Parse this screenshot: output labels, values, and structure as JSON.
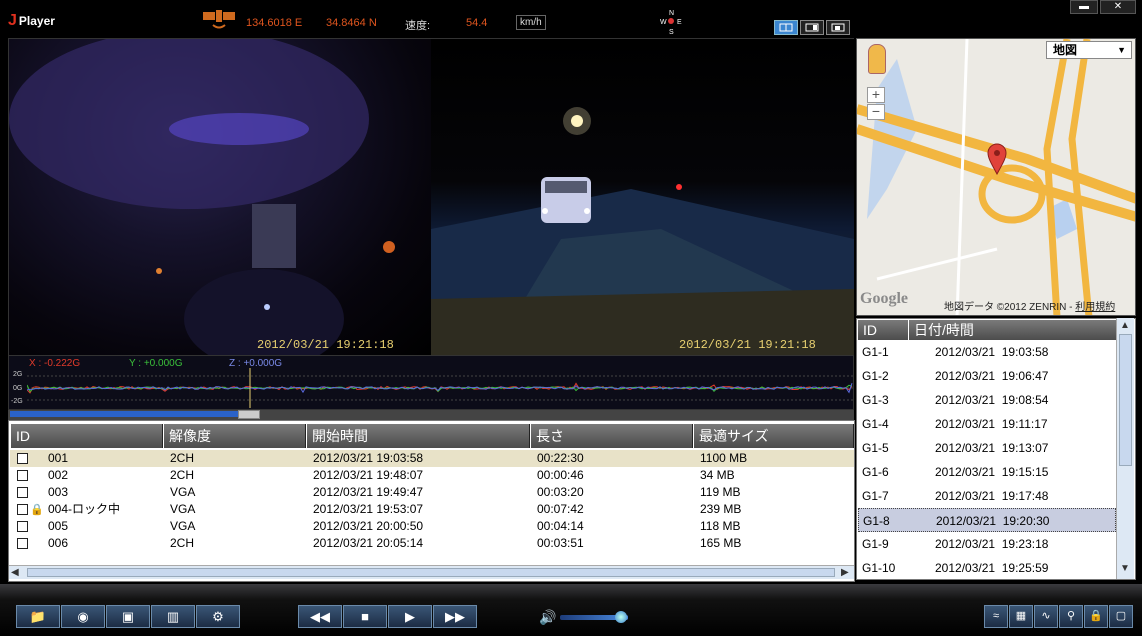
{
  "app": {
    "title": "Player",
    "logo_letter": "J"
  },
  "status": {
    "longitude": "134.6018 E",
    "latitude": "34.8464 N",
    "speed_label": "速度:",
    "speed_value": "54.4",
    "speed_unit": "km/h",
    "compass_letters": [
      "N",
      "W",
      "E",
      "S"
    ]
  },
  "window_controls": {
    "minimize": "▬",
    "close": "✕"
  },
  "video": {
    "left_timestamp": "2012/03/21   19:21:18",
    "right_timestamp": "2012/03/21   19:21:18"
  },
  "accel": {
    "x_label": "X : -0.222G",
    "y_label": "Y : +0.000G",
    "z_label": "Z : +0.000G",
    "y_ticks": [
      "2G",
      "0G",
      "-2G"
    ],
    "colors": {
      "x": "#e03a2a",
      "y": "#3ac03a",
      "z": "#5a6ae0"
    }
  },
  "playback": {
    "progress": 0.28
  },
  "files": {
    "headers": [
      "ID",
      "解像度",
      "開始時間",
      "長さ",
      "最適サイズ"
    ],
    "rows": [
      {
        "id": "001",
        "res": "2CH",
        "start": "2012/03/21 19:03:58",
        "len": "00:22:30",
        "size": "1100 MB",
        "selected": true,
        "locked": false
      },
      {
        "id": "002",
        "res": "2CH",
        "start": "2012/03/21 19:48:07",
        "len": "00:00:46",
        "size": "34 MB",
        "selected": false,
        "locked": false
      },
      {
        "id": "003",
        "res": "VGA",
        "start": "2012/03/21 19:49:47",
        "len": "00:03:20",
        "size": "119 MB",
        "selected": false,
        "locked": false
      },
      {
        "id": "004-ロック中",
        "res": "VGA",
        "start": "2012/03/21 19:53:07",
        "len": "00:07:42",
        "size": "239 MB",
        "selected": false,
        "locked": true
      },
      {
        "id": "005",
        "res": "VGA",
        "start": "2012/03/21 20:00:50",
        "len": "00:04:14",
        "size": "118 MB",
        "selected": false,
        "locked": false
      },
      {
        "id": "006",
        "res": "2CH",
        "start": "2012/03/21 20:05:14",
        "len": "00:03:51",
        "size": "165 MB",
        "selected": false,
        "locked": false
      }
    ]
  },
  "map": {
    "type_select": "地図",
    "credit_prefix": "地図データ ©2012 ZENRIN - ",
    "terms_link": "利用規約",
    "google_text": "Google",
    "zoom_in": "+",
    "zoom_out": "−"
  },
  "segments": {
    "headers": [
      "ID",
      "日付/時間"
    ],
    "rows": [
      {
        "id": "G1-1",
        "dt": "2012/03/21  19:03:58",
        "selected": false
      },
      {
        "id": "G1-2",
        "dt": "2012/03/21  19:06:47",
        "selected": false
      },
      {
        "id": "G1-3",
        "dt": "2012/03/21  19:08:54",
        "selected": false
      },
      {
        "id": "G1-4",
        "dt": "2012/03/21  19:11:17",
        "selected": false
      },
      {
        "id": "G1-5",
        "dt": "2012/03/21  19:13:07",
        "selected": false
      },
      {
        "id": "G1-6",
        "dt": "2012/03/21  19:15:15",
        "selected": false
      },
      {
        "id": "G1-7",
        "dt": "2012/03/21  19:17:48",
        "selected": false
      },
      {
        "id": "G1-8",
        "dt": "2012/03/21  19:20:30",
        "selected": true
      },
      {
        "id": "G1-9",
        "dt": "2012/03/21  19:23:18",
        "selected": false
      },
      {
        "id": "G1-10",
        "dt": "2012/03/21  19:25:59",
        "selected": false
      }
    ]
  },
  "toolbar": {
    "left_icons": [
      "folder-icon",
      "camera-icon",
      "save-icon",
      "trash-icon",
      "gear-icon"
    ],
    "left_glyphs": [
      "📁",
      "◉",
      "▣",
      "▥",
      "⚙"
    ],
    "transport_glyphs": [
      "◀◀",
      "■",
      "▶",
      "▶▶"
    ],
    "volume_level": 0.9,
    "volume_glyph": "🔊",
    "right_icons": [
      "sync-icon",
      "chart-icon",
      "wave-icon",
      "search-icon",
      "lock-icon",
      "window-icon"
    ],
    "right_glyphs": [
      "≈",
      "▦",
      "∿",
      "⚲",
      "🔒",
      "▢"
    ]
  }
}
